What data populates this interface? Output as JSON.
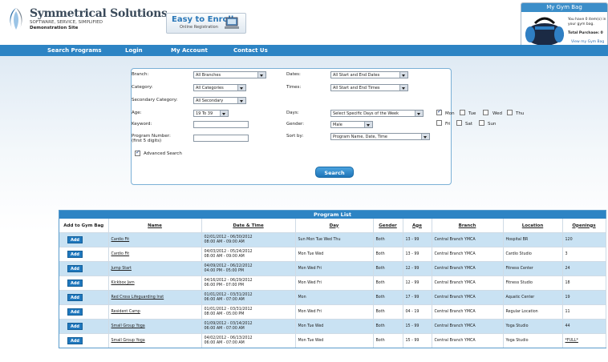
{
  "header": {
    "brand_name": "Symmetrical Solutions",
    "tagline": "SOFTWARE, SERVICE, SIMPLIFIED",
    "site": "Demonstration Site",
    "enroll_big": "Easy to Enroll",
    "enroll_small": "Online Registration"
  },
  "gym_bag": {
    "title": "My Gym Bag",
    "status": "You have 0 item(s) in your gym bag.",
    "total": "Total Purchase: 0",
    "link": "View my Gym Bag"
  },
  "nav": {
    "items": [
      "Search Programs",
      "Login",
      "My Account",
      "Contact Us"
    ]
  },
  "search": {
    "branch_label": "Branch:",
    "branch_value": "All Branches",
    "category_label": "Category:",
    "category_value": "All Categories",
    "secondary_label": "Secondary Category:",
    "secondary_value": "All Secondary",
    "age_label": "Age:",
    "age_value": "19 To 39",
    "keyword_label": "Keyword:",
    "keyword_value": "",
    "program_number_label": "Program Number:",
    "program_number_hint": "(first 5 digits)",
    "program_number_value": "",
    "advanced_label": "Advanced Search",
    "dates_label": "Dates:",
    "dates_value": "All Start and End Dates",
    "times_label": "Times:",
    "times_value": "All Start and End Times",
    "days_label": "Days:",
    "days_value": "Select Specific Days of the Week",
    "gender_label": "Gender:",
    "gender_value": "Male",
    "sort_label": "Sort by:",
    "sort_value": "Program Name, Date, Time",
    "days": [
      {
        "label": "Mon",
        "checked": true
      },
      {
        "label": "Tue",
        "checked": false
      },
      {
        "label": "Wed",
        "checked": false
      },
      {
        "label": "Thu",
        "checked": false
      },
      {
        "label": "Fri",
        "checked": false
      },
      {
        "label": "Sat",
        "checked": false
      },
      {
        "label": "Sun",
        "checked": false
      }
    ],
    "button": "Search"
  },
  "program_list": {
    "title": "Program List",
    "columns": [
      "Add to Gym Bag",
      "Name",
      "Date & Time",
      "Day",
      "Gender",
      "Age",
      "Branch",
      "Location",
      "Openings"
    ],
    "add_label": "Add",
    "rows": [
      {
        "name": "Cardio Fit",
        "dates": "02/01/2012 - 06/30/2012",
        "time": "08:00 AM - 09:00 AM",
        "day": "Sun Mon Tue Wed Thu",
        "gender": "Both",
        "age": "13 - 99",
        "branch": "Central Branch YMCA",
        "location": "Hospital BR",
        "openings": "120"
      },
      {
        "name": "Cardio Fit",
        "dates": "04/03/2012 - 05/24/2012",
        "time": "08:00 AM - 09:00 AM",
        "day": "Mon Tue Wed",
        "gender": "Both",
        "age": "13 - 99",
        "branch": "Central Branch YMCA",
        "location": "Cardio Studio",
        "openings": "3"
      },
      {
        "name": "Jump Start",
        "dates": "04/09/2012 - 06/22/2012",
        "time": "04:00 PM - 05:00 PM",
        "day": "Mon Wed Fri",
        "gender": "Both",
        "age": "12 - 99",
        "branch": "Central Branch YMCA",
        "location": "Fitness Center",
        "openings": "24"
      },
      {
        "name": "Kickbox Jam",
        "dates": "04/16/2012 - 06/29/2012",
        "time": "06:00 PM - 07:00 PM",
        "day": "Mon Wed Fri",
        "gender": "Both",
        "age": "12 - 99",
        "branch": "Central Branch YMCA",
        "location": "Fitness Studio",
        "openings": "18"
      },
      {
        "name": "Red Cross Lifeguarding Inst",
        "dates": "01/01/2012 - 03/31/2012",
        "time": "06:00 AM - 07:00 AM",
        "day": "Mon",
        "gender": "Both",
        "age": "17 - 99",
        "branch": "Central Branch YMCA",
        "location": "Aquatic Center",
        "openings": "19"
      },
      {
        "name": "Resident Camp",
        "dates": "01/01/2012 - 03/31/2012",
        "time": "08:00 AM - 05:00 PM",
        "day": "Mon Wed Fri",
        "gender": "Both",
        "age": "04 - 19",
        "branch": "Central Branch YMCA",
        "location": "Regular Location",
        "openings": "11"
      },
      {
        "name": "Small Group Yoga",
        "dates": "01/09/2012 - 03/14/2012",
        "time": "06:00 AM - 07:00 AM",
        "day": "Mon Tue Wed",
        "gender": "Both",
        "age": "15 - 99",
        "branch": "Central Branch YMCA",
        "location": "Yoga Studio",
        "openings": "44"
      },
      {
        "name": "Small Group Yoga",
        "dates": "04/02/2012 - 06/13/2012",
        "time": "06:00 AM - 07:00 AM",
        "day": "Mon Tue Wed",
        "gender": "Both",
        "age": "15 - 99",
        "branch": "Central Branch YMCA",
        "location": "Yoga Studio",
        "openings": "*FULL*"
      }
    ]
  }
}
